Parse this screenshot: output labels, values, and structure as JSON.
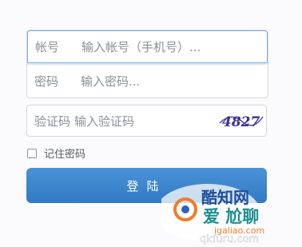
{
  "form": {
    "account": {
      "label": "帐号",
      "placeholder": "输入帐号（手机号）..."
    },
    "password": {
      "label": "密码",
      "placeholder": "输入密码..."
    },
    "captcha": {
      "label": "验证码",
      "placeholder": "输入验证码",
      "code": "4827"
    },
    "remember_label": "记住密码",
    "login_label": "登陆"
  },
  "watermark": {
    "line1": "酷知网",
    "line2": "爱 尬聊",
    "url": "igaliao.com",
    "line3": "qkfuru.com"
  },
  "colors": {
    "focus_border": "#7ab0e6",
    "button": "#3a84cc",
    "watermark_orange": "#f07c2a",
    "watermark_teal": "#1d8f8f",
    "watermark_blue": "#2d62b8"
  }
}
